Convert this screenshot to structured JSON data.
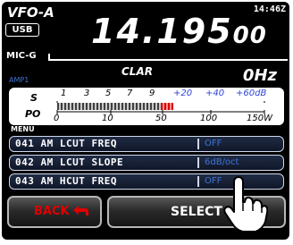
{
  "header": {
    "vfo": "VFO-A",
    "mode": "USB",
    "time": "14:46Z",
    "frequency_main": "14.195",
    "frequency_small": "00",
    "mic_gain_label": "MIC-G"
  },
  "clar": {
    "label": "CLAR",
    "value": "0Hz",
    "amp": "AMP1"
  },
  "meter": {
    "s_label": "S",
    "po_label": "PO",
    "s_scale": [
      "1",
      "3",
      "5",
      "7",
      "9",
      "+20",
      "+40",
      "+60dB"
    ],
    "po_scale": [
      "0",
      "10",
      "50",
      "100",
      "150W"
    ],
    "level_fraction": 0.5,
    "peak_fraction": 0.06
  },
  "menu": {
    "label": "MENU",
    "items": [
      {
        "num": "041",
        "name": "AM LCUT FREQ",
        "value": "OFF"
      },
      {
        "num": "042",
        "name": "AM LCUT SLOPE",
        "value": "6dB/oct"
      },
      {
        "num": "043",
        "name": "AM HCUT FREQ",
        "value": "OFF"
      }
    ]
  },
  "buttons": {
    "back": "BACK",
    "select": "SELECT"
  },
  "colors": {
    "accent_blue": "#3c74d8",
    "back_red": "#e10000",
    "peak_red": "#d70000"
  }
}
